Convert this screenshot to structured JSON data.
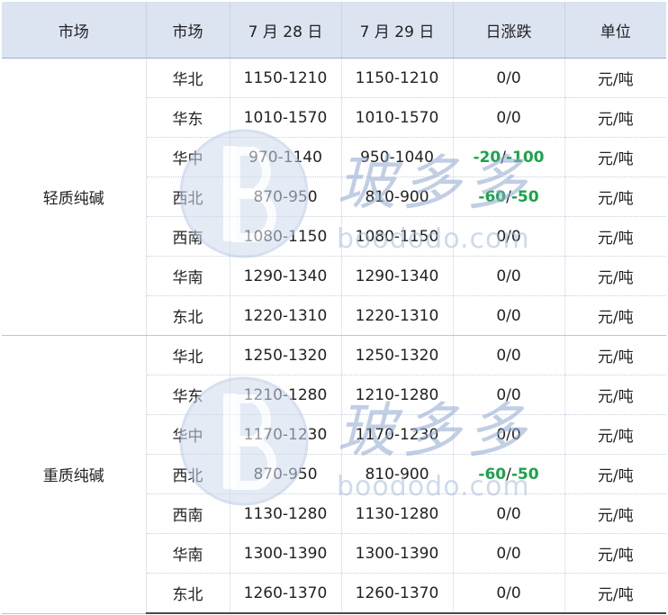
{
  "header": {
    "col_group": "市场",
    "col_market": "市场",
    "col_jul28": "7 月 28 日",
    "col_jul29": "7 月 29 日",
    "col_change": "日涨跌",
    "col_unit": "单位"
  },
  "groups": [
    {
      "name": "轻质纯碱",
      "rows": [
        {
          "market": "华北",
          "jul28": "1150-1210",
          "jul29": "1150-1210",
          "change": "0/0",
          "neg": false,
          "unit": "元/吨"
        },
        {
          "market": "华东",
          "jul28": "1010-1570",
          "jul29": "1010-1570",
          "change": "0/0",
          "neg": false,
          "unit": "元/吨"
        },
        {
          "market": "华中",
          "jul28": "970-1140",
          "jul29": "950-1040",
          "change_a": "-20",
          "change_sep": "/",
          "change_b": "-100",
          "neg": true,
          "unit": "元/吨"
        },
        {
          "market": "西北",
          "jul28": "870-950",
          "jul29": "810-900",
          "change_a": "-60",
          "change_sep": "/",
          "change_b": "-50",
          "neg": true,
          "unit": "元/吨"
        },
        {
          "market": "西南",
          "jul28": "1080-1150",
          "jul29": "1080-1150",
          "change": "0/0",
          "neg": false,
          "unit": "元/吨"
        },
        {
          "market": "华南",
          "jul28": "1290-1340",
          "jul29": "1290-1340",
          "change": "0/0",
          "neg": false,
          "unit": "元/吨"
        },
        {
          "market": "东北",
          "jul28": "1220-1310",
          "jul29": "1220-1310",
          "change": "0/0",
          "neg": false,
          "unit": "元/吨"
        }
      ]
    },
    {
      "name": "重质纯碱",
      "rows": [
        {
          "market": "华北",
          "jul28": "1250-1320",
          "jul29": "1250-1320",
          "change": "0/0",
          "neg": false,
          "unit": "元/吨"
        },
        {
          "market": "华东",
          "jul28": "1210-1280",
          "jul29": "1210-1280",
          "change": "0/0",
          "neg": false,
          "unit": "元/吨"
        },
        {
          "market": "华中",
          "jul28": "1170-1230",
          "jul29": "1170-1230",
          "change": "0/0",
          "neg": false,
          "unit": "元/吨"
        },
        {
          "market": "西北",
          "jul28": "870-950",
          "jul29": "810-900",
          "change_a": "-60",
          "change_sep": "/",
          "change_b": "-50",
          "neg": true,
          "unit": "元/吨"
        },
        {
          "market": "西南",
          "jul28": "1130-1280",
          "jul29": "1130-1280",
          "change": "0/0",
          "neg": false,
          "unit": "元/吨"
        },
        {
          "market": "华南",
          "jul28": "1300-1390",
          "jul29": "1300-1390",
          "change": "0/0",
          "neg": false,
          "unit": "元/吨"
        },
        {
          "market": "东北",
          "jul28": "1260-1370",
          "jul29": "1260-1370",
          "change": "0/0",
          "neg": false,
          "unit": "元/吨"
        }
      ]
    }
  ],
  "watermark": {
    "cn": "玻多多",
    "en": "boododo.com"
  },
  "colors": {
    "header_bg": "#dce4f2",
    "negative_change": "#1aa34a",
    "watermark": "#8fa7cf"
  }
}
